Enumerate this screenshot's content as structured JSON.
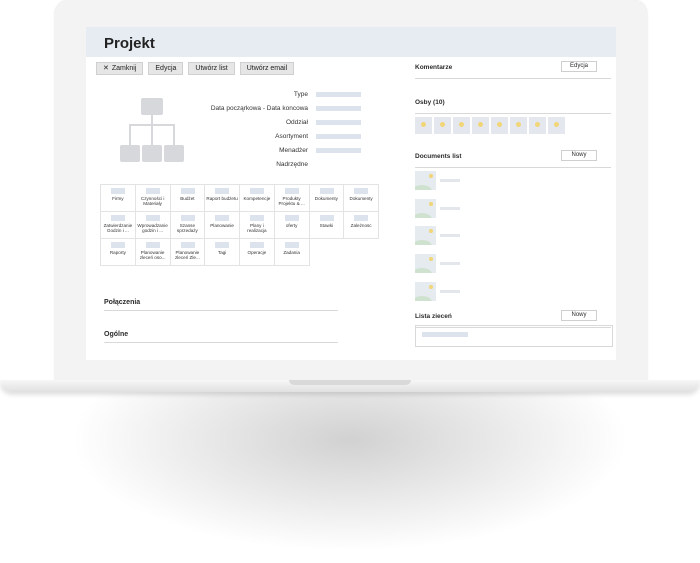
{
  "page": {
    "title": "Projekt"
  },
  "toolbar": {
    "close_label": "Zamknij",
    "close_icon": "✕",
    "edit_label": "Edycja",
    "create_list_label": "Utwórz list",
    "create_email_label": "Utwórz email"
  },
  "fields": [
    {
      "label": "Type"
    },
    {
      "label": "Data począrkowa - Data koncowa"
    },
    {
      "label": "Oddział"
    },
    {
      "label": "Asortyment"
    },
    {
      "label": "Menadżer"
    },
    {
      "label": "Nadrzędne"
    }
  ],
  "modules": [
    "Firmy",
    "Czynności i Materiały",
    "Budżet",
    "Raport budżetu",
    "Kompetencje",
    "Produkty Projektu & ...",
    "Dokumenty",
    "Dokumenty",
    "Zatwierdzanie Godzin i ...",
    "Wprowadzanie godzin i ...",
    "Szanse sprzedaży",
    "Planowanie",
    "Plany i realizacja",
    "oferty",
    "Stawki",
    "Zależnosc",
    "Raporty",
    "Planowanie zleceń oso...",
    "Planowanie zleceń Zle...",
    "Tagi",
    "Operacje",
    "Zadania"
  ],
  "sections": {
    "connections": "Połączenia",
    "general": "Ogólne"
  },
  "right": {
    "comments_title": "Komentarze",
    "comments_button": "Edycja",
    "people_title": "Osby (10)",
    "people_count_shown": 8,
    "documents_title": "Documents list",
    "documents_button": "Nowy",
    "documents_count": 5,
    "orders_title": "Lista zieceń",
    "orders_button": "Nowy"
  },
  "colors": {
    "header_bg": "#e7ecf3",
    "placeholder": "#dde3ec",
    "avatar_dot": "#f1d577"
  }
}
